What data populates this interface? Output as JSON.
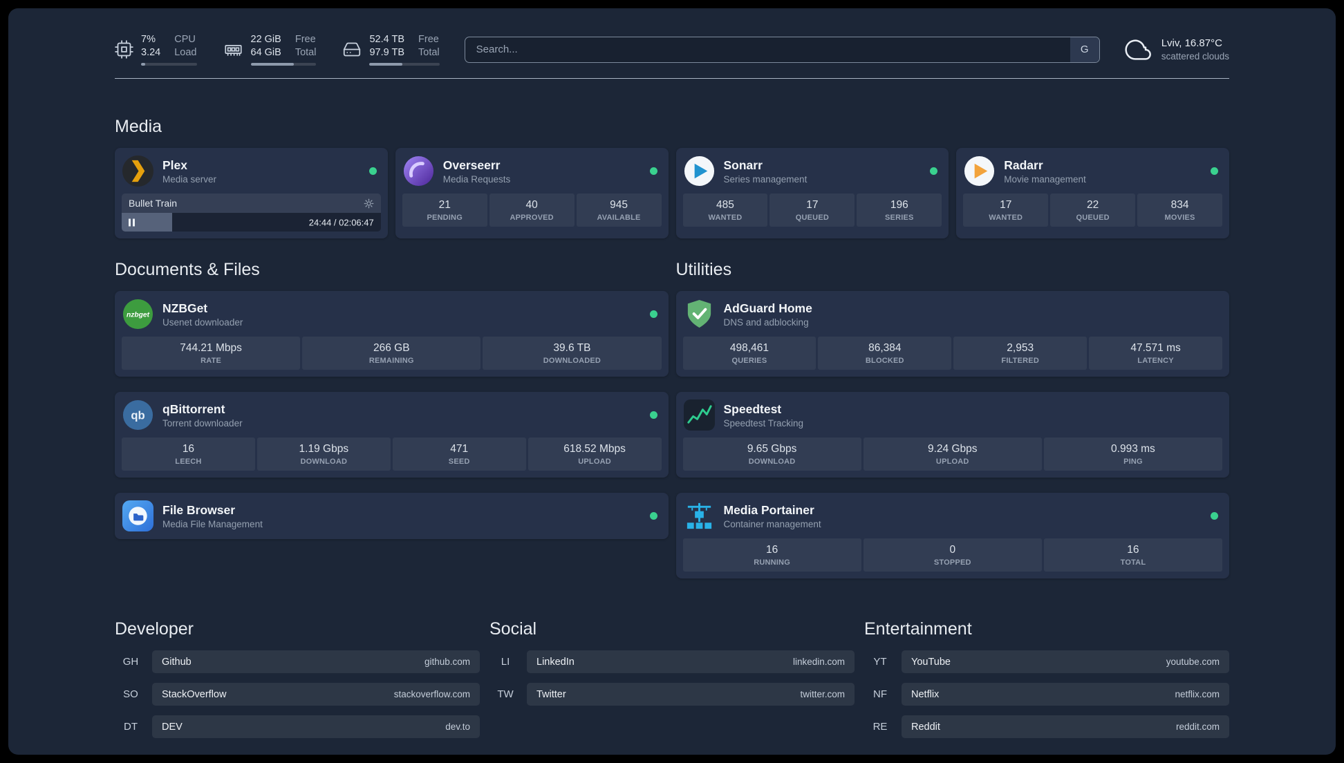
{
  "theme": {
    "background": "#1c2637",
    "card": "#263149",
    "status_green": "#3ad18f"
  },
  "topbar": {
    "cpu": {
      "value": "7%",
      "sub": "3.24",
      "label": "CPU",
      "sublabel": "Load",
      "fill": "7%"
    },
    "memory": {
      "value": "22 GiB",
      "sub": "64 GiB",
      "label": "Free",
      "sublabel": "Total",
      "fill": "66%"
    },
    "disk": {
      "value": "52.4 TB",
      "sub": "97.9 TB",
      "label": "Free",
      "sublabel": "Total",
      "fill": "47%"
    },
    "search": {
      "placeholder": "Search...",
      "provider_button": "G"
    },
    "weather": {
      "location": "Lviv, 16.87°C",
      "condition": "scattered clouds"
    }
  },
  "media": {
    "title": "Media",
    "plex": {
      "name": "Plex",
      "desc": "Media server",
      "now_playing": "Bullet Train",
      "time": "24:44 / 02:06:47",
      "progress": "19.5%"
    },
    "overseerr": {
      "name": "Overseerr",
      "desc": "Media Requests",
      "stats": [
        {
          "value": "21",
          "label": "PENDING"
        },
        {
          "value": "40",
          "label": "APPROVED"
        },
        {
          "value": "945",
          "label": "AVAILABLE"
        }
      ]
    },
    "sonarr": {
      "name": "Sonarr",
      "desc": "Series management",
      "stats": [
        {
          "value": "485",
          "label": "WANTED"
        },
        {
          "value": "17",
          "label": "QUEUED"
        },
        {
          "value": "196",
          "label": "SERIES"
        }
      ]
    },
    "radarr": {
      "name": "Radarr",
      "desc": "Movie management",
      "stats": [
        {
          "value": "17",
          "label": "WANTED"
        },
        {
          "value": "22",
          "label": "QUEUED"
        },
        {
          "value": "834",
          "label": "MOVIES"
        }
      ]
    }
  },
  "documents": {
    "title": "Documents & Files",
    "nzbget": {
      "name": "NZBGet",
      "desc": "Usenet downloader",
      "icon_label": "nzbget",
      "stats": [
        {
          "value": "744.21 Mbps",
          "label": "RATE"
        },
        {
          "value": "266 GB",
          "label": "REMAINING"
        },
        {
          "value": "39.6 TB",
          "label": "DOWNLOADED"
        }
      ]
    },
    "qbittorrent": {
      "name": "qBittorrent",
      "desc": "Torrent downloader",
      "icon_label": "qb",
      "stats": [
        {
          "value": "16",
          "label": "LEECH"
        },
        {
          "value": "1.19 Gbps",
          "label": "DOWNLOAD"
        },
        {
          "value": "471",
          "label": "SEED"
        },
        {
          "value": "618.52 Mbps",
          "label": "UPLOAD"
        }
      ]
    },
    "filebrowser": {
      "name": "File Browser",
      "desc": "Media File Management"
    }
  },
  "utilities": {
    "title": "Utilities",
    "adguard": {
      "name": "AdGuard Home",
      "desc": "DNS and adblocking",
      "stats": [
        {
          "value": "498,461",
          "label": "QUERIES"
        },
        {
          "value": "86,384",
          "label": "BLOCKED"
        },
        {
          "value": "2,953",
          "label": "FILTERED"
        },
        {
          "value": "47.571 ms",
          "label": "LATENCY"
        }
      ]
    },
    "speedtest": {
      "name": "Speedtest",
      "desc": "Speedtest Tracking",
      "stats": [
        {
          "value": "9.65 Gbps",
          "label": "DOWNLOAD"
        },
        {
          "value": "9.24 Gbps",
          "label": "UPLOAD"
        },
        {
          "value": "0.993 ms",
          "label": "PING"
        }
      ]
    },
    "portainer": {
      "name": "Media Portainer",
      "desc": "Container management",
      "stats": [
        {
          "value": "16",
          "label": "RUNNING"
        },
        {
          "value": "0",
          "label": "STOPPED"
        },
        {
          "value": "16",
          "label": "TOTAL"
        }
      ]
    }
  },
  "bookmarks": {
    "developer": {
      "title": "Developer",
      "items": [
        {
          "abbr": "GH",
          "name": "Github",
          "url": "github.com"
        },
        {
          "abbr": "SO",
          "name": "StackOverflow",
          "url": "stackoverflow.com"
        },
        {
          "abbr": "DT",
          "name": "DEV",
          "url": "dev.to"
        }
      ]
    },
    "social": {
      "title": "Social",
      "items": [
        {
          "abbr": "LI",
          "name": "LinkedIn",
          "url": "linkedin.com"
        },
        {
          "abbr": "TW",
          "name": "Twitter",
          "url": "twitter.com"
        }
      ]
    },
    "entertainment": {
      "title": "Entertainment",
      "items": [
        {
          "abbr": "YT",
          "name": "YouTube",
          "url": "youtube.com"
        },
        {
          "abbr": "NF",
          "name": "Netflix",
          "url": "netflix.com"
        },
        {
          "abbr": "RE",
          "name": "Reddit",
          "url": "reddit.com"
        }
      ]
    }
  }
}
